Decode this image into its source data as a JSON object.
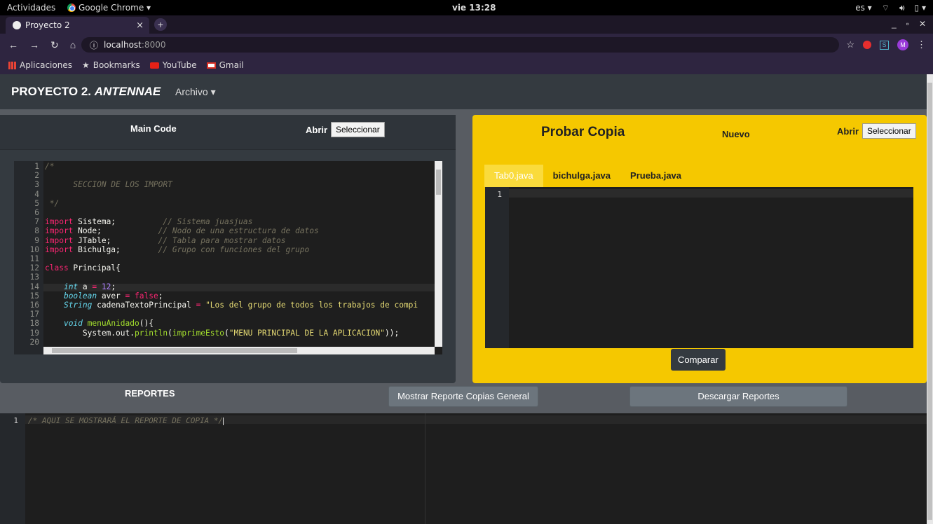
{
  "system_bar": {
    "activities": "Actividades",
    "app_name": "Google Chrome ▾",
    "clock": "vie 13:28",
    "language": "es ▾"
  },
  "browser": {
    "tab_title": "Proyecto 2",
    "tab_close": "×",
    "new_tab": "+",
    "url_host": "localhost",
    "url_port": ":8000",
    "bookmarks": [
      "Aplicaciones",
      "Bookmarks",
      "YouTube",
      "Gmail"
    ],
    "profile_initial": "M"
  },
  "navbar": {
    "brand": "PROYECTO 2.",
    "brand_italic": "ANTENNAE",
    "menu": "Archivo ▾"
  },
  "main_panel": {
    "title": "Main Code",
    "open_label": "Abrir",
    "select_button": "Seleccionar"
  },
  "code_lines": [
    {
      "n": "1",
      "text": "/*"
    },
    {
      "n": "2",
      "text": ""
    },
    {
      "n": "3",
      "text": "      SECCION DE LOS IMPORT"
    },
    {
      "n": "4",
      "text": ""
    },
    {
      "n": "5",
      "text": " */"
    },
    {
      "n": "6",
      "text": ""
    },
    {
      "n": "7",
      "text": "import Sistema;          // Sistema juasjuas"
    },
    {
      "n": "8",
      "text": "import Node;            // Nodo de una estructura de datos"
    },
    {
      "n": "9",
      "text": "import JTable;          // Tabla para mostrar datos"
    },
    {
      "n": "10",
      "text": "import Bichulga;        // Grupo con funciones del grupo"
    },
    {
      "n": "11",
      "text": ""
    },
    {
      "n": "12",
      "text": "class Principal{"
    },
    {
      "n": "13",
      "text": ""
    },
    {
      "n": "14",
      "text": "    int a = 12;"
    },
    {
      "n": "15",
      "text": "    boolean aver = false;"
    },
    {
      "n": "16",
      "text": "    String cadenaTextoPrincipal = \"Los del grupo de todos los trabajos de compi"
    },
    {
      "n": "17",
      "text": ""
    },
    {
      "n": "18",
      "text": "    void menuAnidado(){"
    },
    {
      "n": "19",
      "text": "        System.out.println(imprimeEsto(\"MENU PRINCIPAL DE LA APLICACION\"));"
    },
    {
      "n": "20",
      "text": ""
    }
  ],
  "test_panel": {
    "title": "Probar Copia",
    "new_label": "Nuevo",
    "open_label": "Abrir",
    "select_button": "Seleccionar",
    "tabs": [
      "Tab0.java",
      "bichulga.java",
      "Prueba.java"
    ],
    "line_number": "1",
    "compare_button": "Comparar"
  },
  "reports": {
    "title": "REPORTES",
    "show_button": "Mostrar Reporte Copias General",
    "download_button": "Descargar Reportes",
    "line_number": "1",
    "content": "/* AQUI SE MOSTRARÁ EL REPORTE DE COPIA */"
  }
}
